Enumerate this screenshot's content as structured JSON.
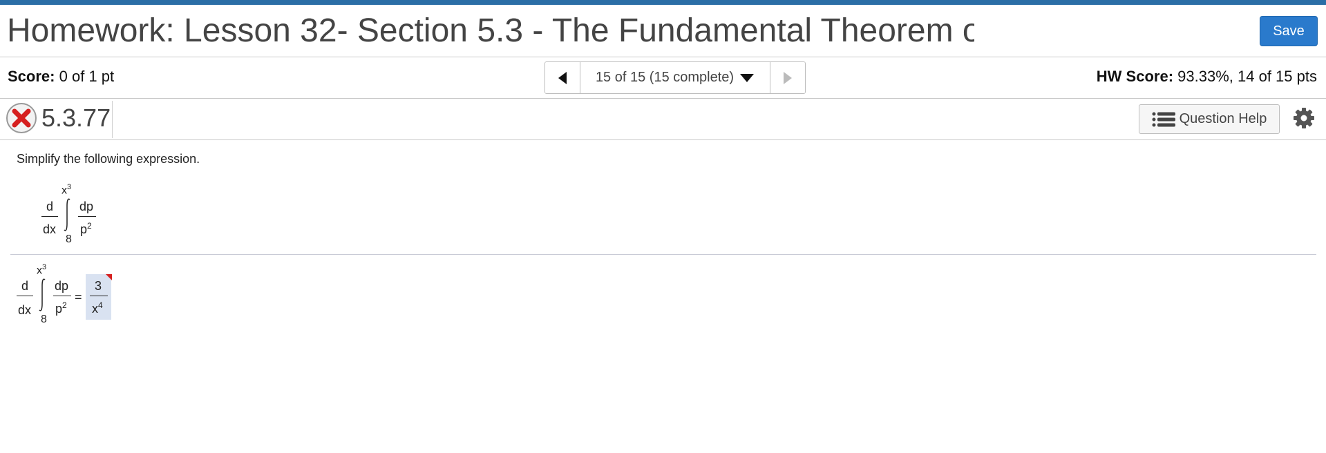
{
  "header": {
    "title": "Homework: Lesson 32- Section 5.3 - The Fundamental Theorem o",
    "save_label": "Save"
  },
  "score": {
    "label": "Score:",
    "value": "0 of 1 pt"
  },
  "navigation": {
    "position_label": "15 of 15 (15 complete)"
  },
  "hw_score": {
    "label": "HW Score:",
    "value": "93.33%, 14 of 15 pts"
  },
  "question": {
    "id": "5.3.77",
    "status": "incorrect",
    "help_label": "Question Help",
    "prompt": "Simplify the following expression."
  },
  "expression": {
    "d_num": "d",
    "d_den": "dx",
    "upper_limit_base": "x",
    "upper_limit_exp": "3",
    "lower_limit": "8",
    "integrand_num": "dp",
    "integrand_den_base": "p",
    "integrand_den_exp": "2"
  },
  "answer": {
    "equals": "=",
    "numerator": "3",
    "denominator_base": "x",
    "denominator_exp": "4"
  },
  "colors": {
    "accent": "#2b6ea6",
    "save_button": "#2a7acc",
    "incorrect": "#d62020",
    "answer_highlight": "#d9e2f1"
  }
}
